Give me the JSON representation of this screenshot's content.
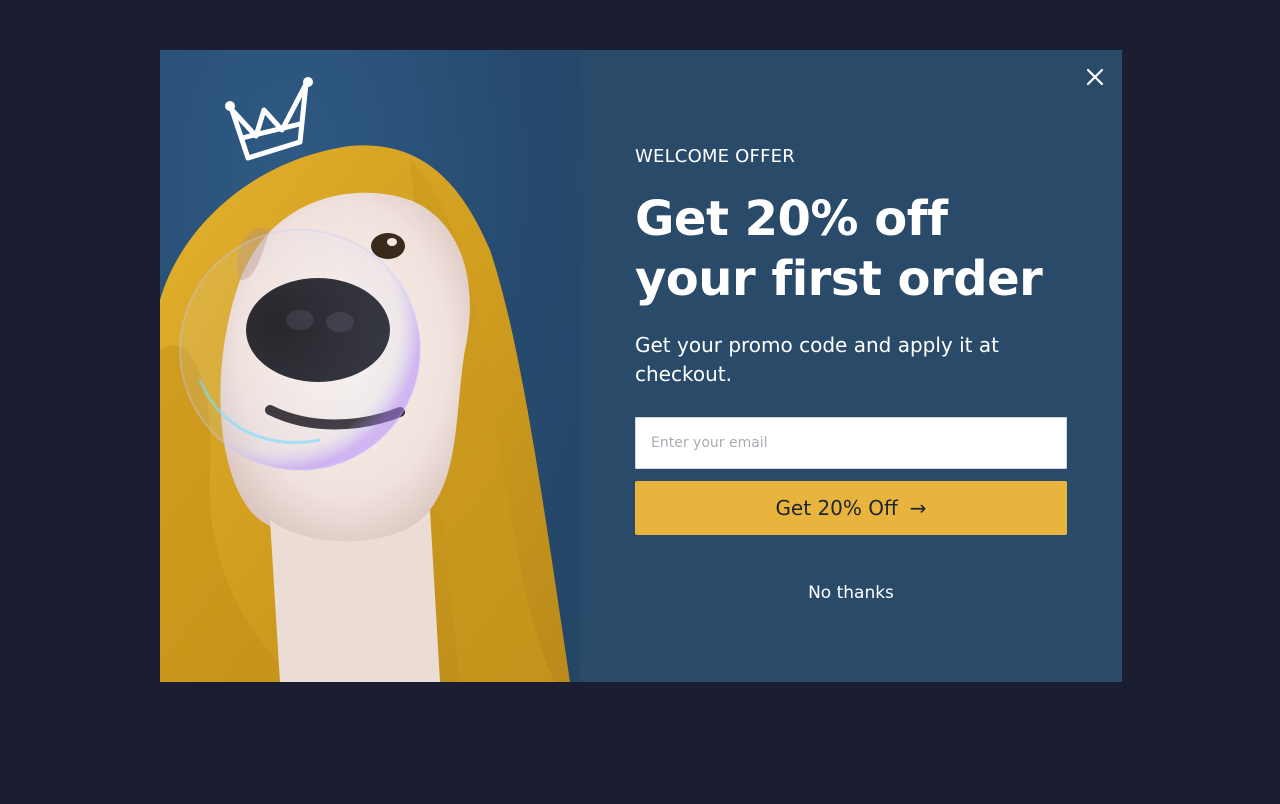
{
  "popup": {
    "eyebrow": "WELCOME OFFER",
    "headline_line1": "Get 20% off",
    "headline_line2": "your first order",
    "subtext": "Get your promo code and apply it at checkout.",
    "email_placeholder": "Enter your email",
    "cta_label": "Get 20% Off",
    "cta_arrow": "→",
    "dismiss_label": "No thanks",
    "close_icon": "close-icon",
    "hero_image": "dog-in-yellow-towel-with-crown-doodle-and-bubbles"
  },
  "colors": {
    "backdrop": "#1b1e33",
    "modal_background": "#2a4a6a",
    "accent": "#e8b43e",
    "text": "#ffffff"
  }
}
